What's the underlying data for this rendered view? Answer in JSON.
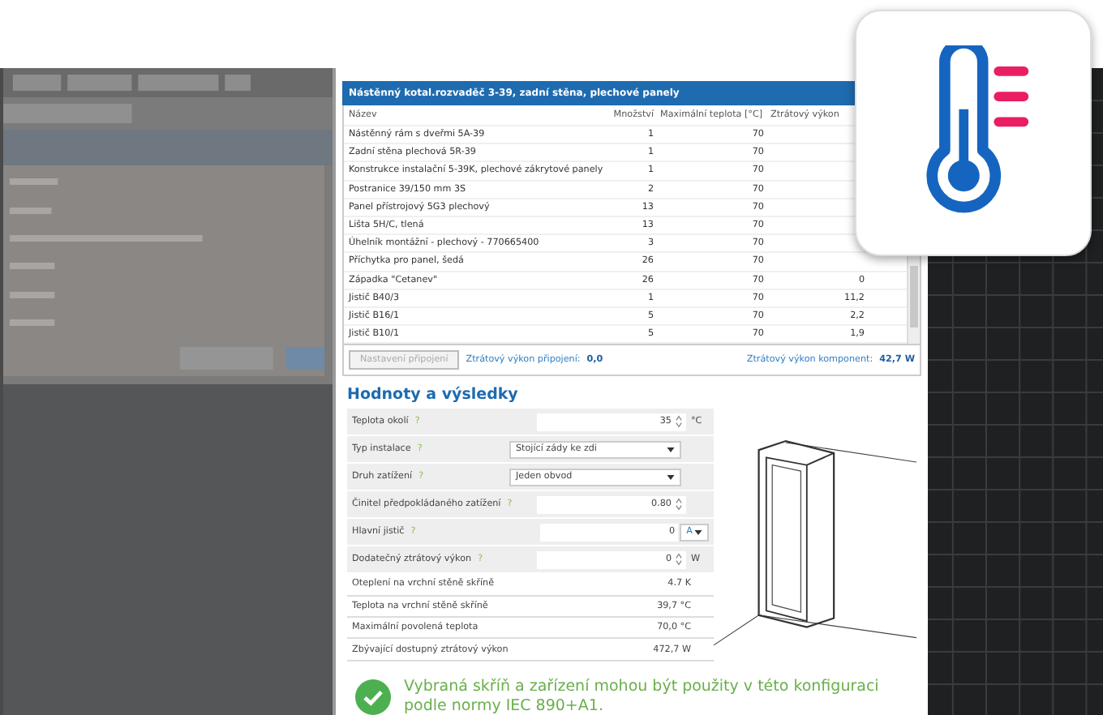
{
  "dialog_title": "Nástěnný kotal.rozvaděč 3-39, zadní stěna, plechové panely",
  "table": {
    "columns": [
      "Název",
      "Množství",
      "Maximální teplota [°C]",
      "Ztrátový výkon"
    ],
    "rows": [
      {
        "name": "Nástěnný rám s dveřmi 5A-39",
        "qty": "1",
        "max_temp": "70"
      },
      {
        "name": "Zadní stěna plechová 5R-39",
        "qty": "1",
        "max_temp": "70"
      },
      {
        "name": "Konstrukce instalační 5-39K, plechové zákrytové panely",
        "qty": "1",
        "max_temp": "70"
      },
      {
        "name": "Postranice 39/150 mm 3S",
        "qty": "2",
        "max_temp": "70"
      },
      {
        "name": "Panel přístrojový 5G3 plechový",
        "qty": "13",
        "max_temp": "70"
      },
      {
        "name": "Lišta 5H/C, tlená",
        "qty": "13",
        "max_temp": "70"
      },
      {
        "name": "Úhelník montážní - plechový - 770665400",
        "qty": "3",
        "max_temp": "70"
      },
      {
        "name": "Příchytka pro panel, šedá",
        "qty": "26",
        "max_temp": "70"
      },
      {
        "name": "Západka \"Cetanev\"",
        "qty": "26",
        "max_temp": "70",
        "loss": "0"
      },
      {
        "name": "Jistič  B40/3",
        "qty": "1",
        "max_temp": "70",
        "loss": "11,2"
      },
      {
        "name": "Jistič  B16/1",
        "qty": "5",
        "max_temp": "70",
        "loss": "2,2"
      },
      {
        "name": "Jistič  B10/1",
        "qty": "5",
        "max_temp": "70",
        "loss": "1,9"
      }
    ]
  },
  "footer": {
    "button": {
      "label": "Nastavení připojení",
      "disabled": true
    },
    "connection_loss": {
      "label": "Ztrátový výkon připojení:",
      "value": "0,0"
    },
    "component_loss": {
      "label": "Ztrátový výkon komponent:",
      "value": "42,7 W"
    }
  },
  "results": {
    "title": "Hodnoty a výsledky",
    "rows": [
      {
        "kind": "number",
        "label": "Teplota okolí",
        "help": "?",
        "value": "35",
        "unit": "°C"
      },
      {
        "kind": "select",
        "label": "Typ instalace",
        "help": "?",
        "value": "Stojící zády ke zdi"
      },
      {
        "kind": "select",
        "label": "Druh zatížení",
        "help": "?",
        "value": "Jeden obvod"
      },
      {
        "kind": "number",
        "label": "Činitel předpokládaného zatížení",
        "help": "?",
        "value": "0.80"
      },
      {
        "kind": "unit_select",
        "label": "Hlavní jistič",
        "help": "?",
        "value": "0",
        "unit": "A"
      },
      {
        "kind": "number",
        "label": "Dodatečný ztrátový výkon",
        "help": "?",
        "value": "0",
        "unit": "W"
      },
      {
        "kind": "output",
        "label": "Oteplení na vrchní stěně skříně",
        "value": "4.7 K"
      },
      {
        "kind": "output",
        "label": "Teplota na vrchní stěně skříně",
        "value": "39,7 °C"
      },
      {
        "kind": "output",
        "label": "Maximální povolená teplota",
        "value": "70,0 °C"
      },
      {
        "kind": "output",
        "label": "Zbývající dostupný ztrátový výkon",
        "value": "472,7 W"
      }
    ]
  },
  "message": {
    "text": "Vybraná skříň a zařízení mohou být použity v této konfiguraci podle normy IEC 890+A1."
  }
}
